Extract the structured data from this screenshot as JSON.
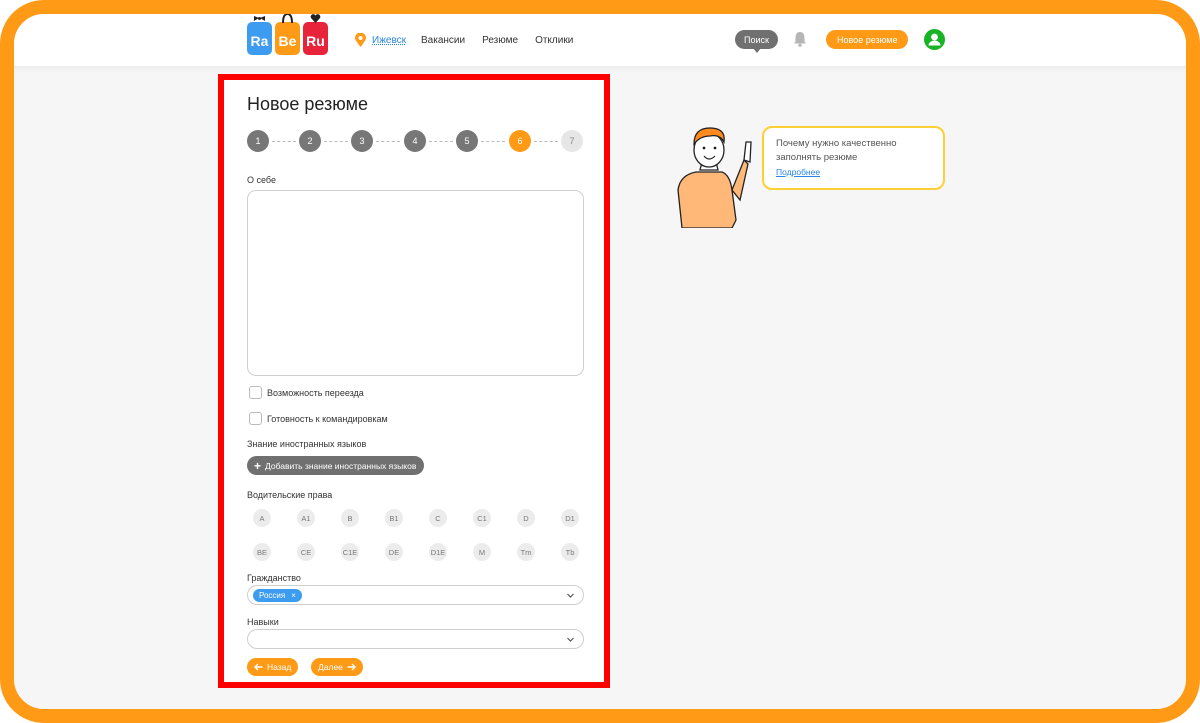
{
  "header": {
    "logo_letters": [
      "Ra",
      "Be",
      "Ru"
    ],
    "city": "Ижевск",
    "nav": [
      "Вакансии",
      "Резюме",
      "Отклики"
    ],
    "search_label": "Поиск",
    "new_resume_label": "Новое резюме"
  },
  "form": {
    "title": "Новое резюме",
    "steps": [
      "1",
      "2",
      "3",
      "4",
      "5",
      "6",
      "7"
    ],
    "active_step": 6,
    "about_label": "О себе",
    "about_value": "",
    "relocation_label": "Возможность переезда",
    "relocation_checked": false,
    "business_trips_label": "Готовность к командировкам",
    "business_trips_checked": false,
    "languages_label": "Знание иностранных языков",
    "add_language_label": "Добавить знание иностранных языков",
    "license_label": "Водительские права",
    "license_categories": [
      "A",
      "A1",
      "B",
      "B1",
      "C",
      "C1",
      "D",
      "D1",
      "BE",
      "CE",
      "C1E",
      "DE",
      "D1E",
      "M",
      "Tm",
      "Tb"
    ],
    "citizenship_label": "Гражданство",
    "citizenship_value": "Россия",
    "skills_label": "Навыки",
    "skills_value": "",
    "back_label": "Назад",
    "next_label": "Далее"
  },
  "tip": {
    "text": "Почему нужно качественно заполнять резюме",
    "link": "Подробнее"
  },
  "colors": {
    "accent": "#ff9a16",
    "link": "#2a86e4",
    "highlight_border": "#ff0000",
    "avatar": "#19b326"
  }
}
